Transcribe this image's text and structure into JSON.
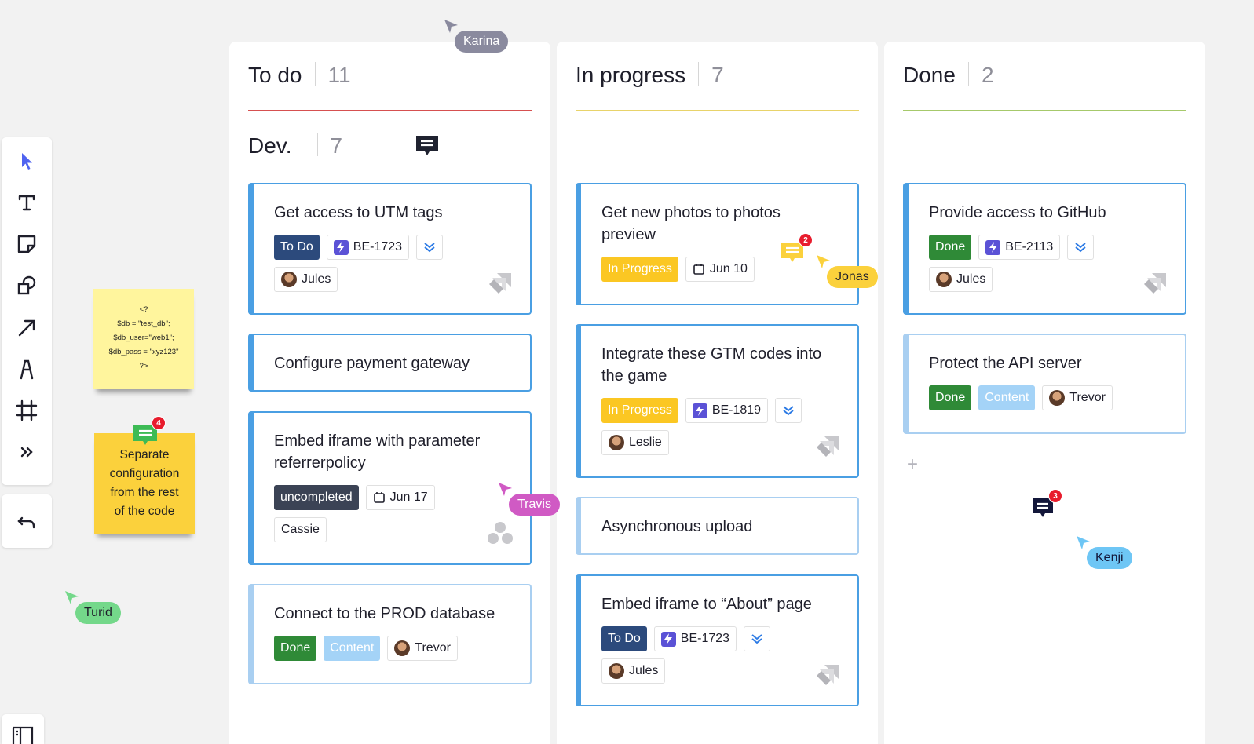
{
  "toolbar": {
    "tools": [
      "select-tool",
      "text-tool",
      "sticky-note-tool",
      "shapes-tool",
      "arrow-tool",
      "pen-tool",
      "frame-tool",
      "more-tools"
    ],
    "accent": "#4f63f0"
  },
  "stickies": {
    "code_lines": [
      "<?",
      "$db = \"test_db\";",
      "$db_user=\"web1\";",
      "$db_pass = \"xyz123\"",
      "?>"
    ],
    "note_lines": [
      "Separate",
      "configuration",
      "from the rest",
      "of the code"
    ],
    "note_comments": "4"
  },
  "columns": {
    "todo": {
      "title": "To do",
      "count": "11",
      "color": "#d65050"
    },
    "progress": {
      "title": "In progress",
      "count": "7",
      "color": "#e8d36a"
    },
    "done": {
      "title": "Done",
      "count": "2",
      "color": "#a6c96b"
    }
  },
  "swimlane": {
    "title": "Dev.",
    "count": "7"
  },
  "cards": {
    "c1": {
      "title": "Get access to UTM tags",
      "status": "To Do",
      "key": "BE-1723",
      "assignee": "Jules"
    },
    "c2": {
      "title": "Configure payment gateway"
    },
    "c3": {
      "title_1": "Embed iframe with parameter",
      "title_2": "referrerpolicy",
      "status": "uncompleted",
      "date": "Jun 17",
      "assignee": "Cassie"
    },
    "c4": {
      "title": "Connect to the PROD database",
      "status": "Done",
      "label": "Content",
      "assignee": "Trevor"
    },
    "p1": {
      "title_1": "Get new photos to photos",
      "title_2": "preview",
      "status": "In Progress",
      "date": "Jun 10",
      "comments": "2"
    },
    "p2": {
      "title_1": "Integrate these GTM codes into",
      "title_2": "the game",
      "status": "In Progress",
      "key": "BE-1819",
      "assignee": "Leslie"
    },
    "p3": {
      "title": "Asynchronous upload"
    },
    "p4": {
      "title": "Embed iframe to “About” page",
      "status": "To Do",
      "key": "BE-1723",
      "assignee": "Jules"
    },
    "d1": {
      "title": "Provide access to GitHub",
      "status": "Done",
      "key": "BE-2113",
      "assignee": "Jules"
    },
    "d2": {
      "title": "Protect the API server",
      "status": "Done",
      "label": "Content",
      "assignee": "Trevor"
    }
  },
  "board_comment_count": "3",
  "cursors": {
    "karina": {
      "name": "Karina",
      "color": "#8a8a9e"
    },
    "jonas": {
      "name": "Jonas",
      "color": "#fbd13c"
    },
    "travis": {
      "name": "Travis",
      "color": "#d05ac4"
    },
    "kenji": {
      "name": "Kenji",
      "color": "#6ec6f5"
    },
    "turid": {
      "name": "Turid",
      "color": "#74d88a"
    }
  }
}
